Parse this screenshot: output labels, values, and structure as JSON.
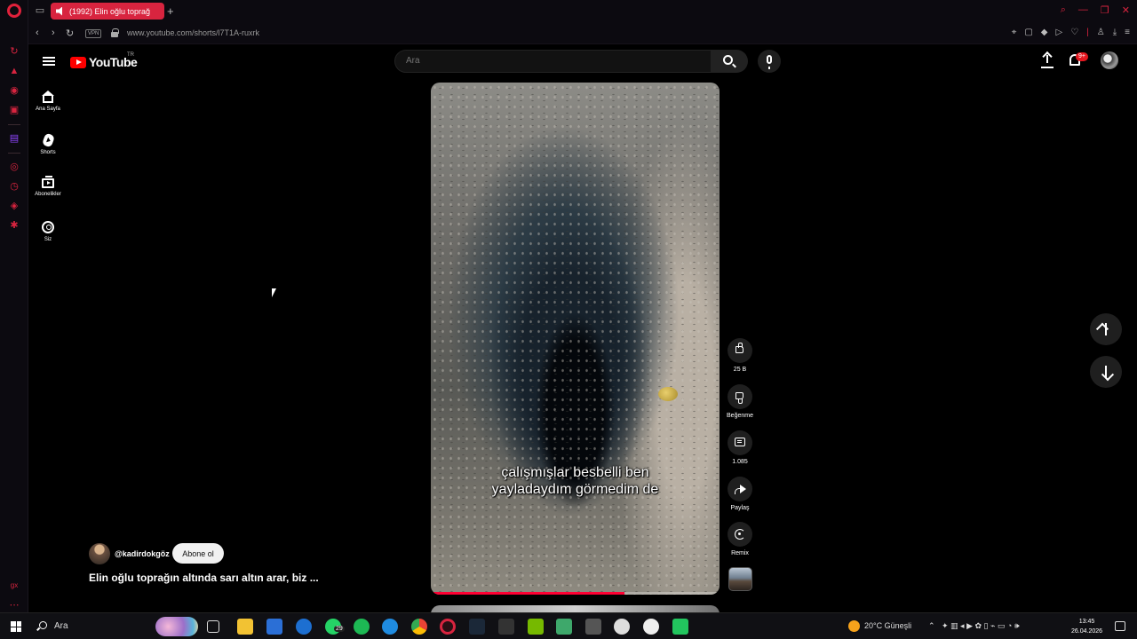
{
  "browser": {
    "tab_title": "(1992) Elin oğlu toprağ",
    "new_tab": "+",
    "vpn_label": "VPN",
    "url": "www.youtube.com/shorts/l7T1A-ruxrk",
    "back_icon": "chevron-left",
    "forward_icon": "chevron-right",
    "reload_icon": "reload"
  },
  "youtube": {
    "logo_text": "YouTube",
    "region": "TR",
    "search_placeholder": "Ara",
    "notifications_badge": "9+",
    "sidebar": [
      {
        "label": "Ana Sayfa",
        "icon": "home-icon"
      },
      {
        "label": "Shorts",
        "icon": "shorts-icon"
      },
      {
        "label": "Abonelikler",
        "icon": "subscriptions-icon"
      },
      {
        "label": "Siz",
        "icon": "you-icon"
      }
    ]
  },
  "short": {
    "caption_line1": "çalışmışlar besbelli ben",
    "caption_line2": "yayladaydım görmedim de",
    "progress": 0.67,
    "channel": "@kadirdokgöz",
    "subscribe_label": "Abone ol",
    "title": "Elin oğlu toprağın altında sarı altın arar, biz ...",
    "actions": {
      "like_count": "25 B",
      "dislike_label": "Beğenme",
      "comment_count": "1.085",
      "share_label": "Paylaş",
      "remix_label": "Remix"
    }
  },
  "taskbar": {
    "search_text": "Ara",
    "whatsapp_badge": "29",
    "weather": "20°C  Güneşli",
    "time": "13:45",
    "date": "26.04.2026"
  },
  "colors": {
    "opera_red": "#d8243f",
    "youtube_red": "#ff0000",
    "progress_red": "#ff0033"
  }
}
